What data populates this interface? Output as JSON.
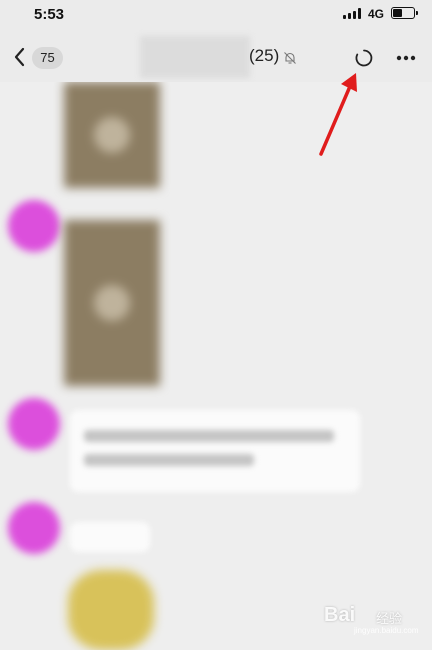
{
  "status_bar": {
    "time": "5:53",
    "network": "4G",
    "battery_fraction": 0.45
  },
  "header": {
    "unread_count": "75",
    "member_count": "(25)",
    "icons": {
      "back": "chevron-left-icon",
      "mute": "bell-off-icon",
      "refresh": "refresh-circle-icon",
      "more": "more-horizontal-icon"
    }
  },
  "watermark": {
    "brand": "Bai",
    "product": "经验",
    "url": "jingyan.baidu.com"
  },
  "colors": {
    "background": "#ebebeb",
    "avatar": "#dc4fdc",
    "annotation_arrow": "#e01c1c"
  }
}
